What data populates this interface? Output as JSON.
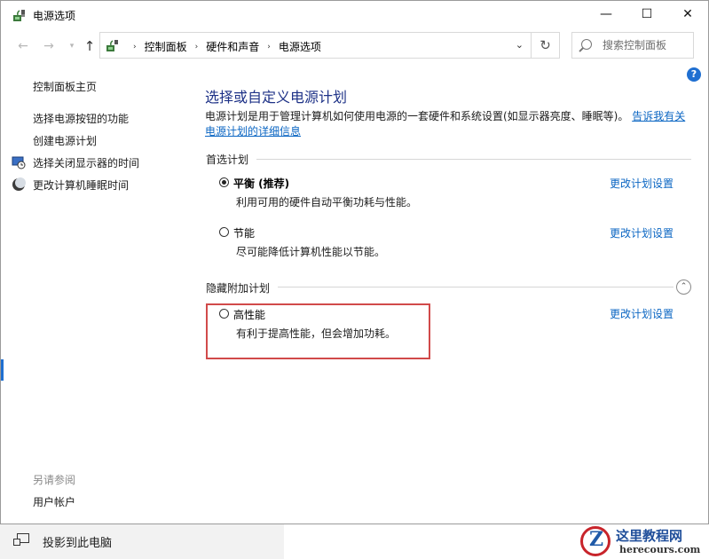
{
  "window": {
    "title": "电源选项",
    "minimize": "—",
    "maximize": "☐",
    "close": "✕"
  },
  "nav": {
    "back": "←",
    "forward": "→",
    "dropdown": "▾",
    "up": "↑",
    "breadcrumbs": [
      "控制面板",
      "硬件和声音",
      "电源选项"
    ],
    "separator": "›",
    "address_dropdown": "⌄",
    "refresh": "↻",
    "search_placeholder": "搜索控制面板"
  },
  "help": "?",
  "sidebar": {
    "home": "控制面板主页",
    "items": [
      {
        "label": "选择电源按钮的功能",
        "icon": ""
      },
      {
        "label": "创建电源计划",
        "icon": ""
      },
      {
        "label": "选择关闭显示器的时间",
        "icon": "monitor-clock-icon"
      },
      {
        "label": "更改计算机睡眠时间",
        "icon": "moon-icon"
      }
    ],
    "see_also": "另请参阅",
    "user_accounts": "用户帐户"
  },
  "main": {
    "title": "选择或自定义电源计划",
    "description": "电源计划是用于管理计算机如何使用电源的一套硬件和系统设置(如显示器亮度、睡眠等)。",
    "description_link": "告诉我有关电源计划的详细信息",
    "preferred_label": "首选计划",
    "hidden_label": "隐藏附加计划",
    "collapse": "⌃",
    "change_link": "更改计划设置",
    "plans": [
      {
        "name": "平衡 (推荐)",
        "desc": "利用可用的硬件自动平衡功耗与性能。",
        "selected": true
      },
      {
        "name": "节能",
        "desc": "尽可能降低计算机性能以节能。",
        "selected": false
      },
      {
        "name": "高性能",
        "desc": "有利于提高性能，但会增加功耗。",
        "selected": false
      }
    ]
  },
  "taskbar": {
    "project_label": "投影到此电脑"
  },
  "watermark": {
    "letter": "Z",
    "title": "这里教程网",
    "url": "herecours.com"
  },
  "colors": {
    "accent": "#1e3287",
    "link": "#0b66c3",
    "highlight_border": "#d14a4a"
  }
}
